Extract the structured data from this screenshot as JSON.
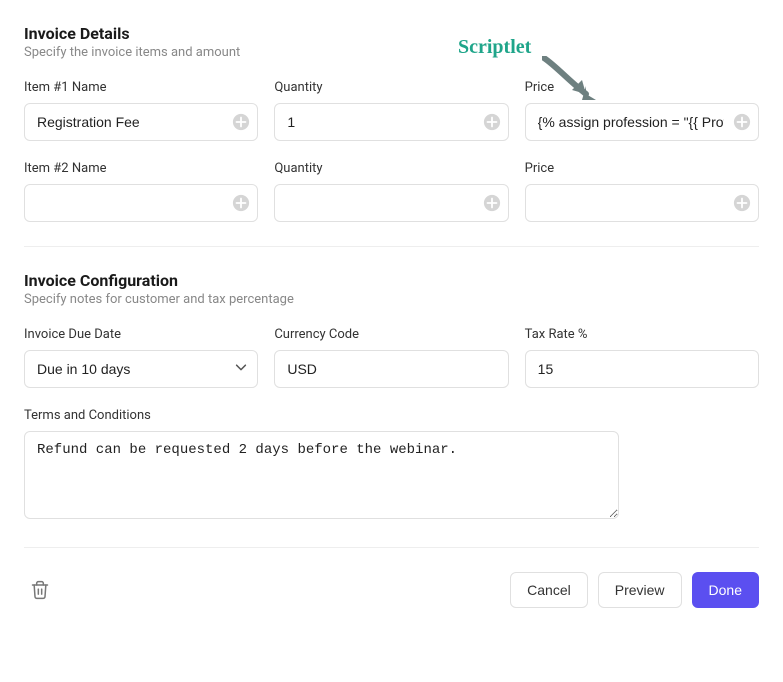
{
  "details": {
    "title": "Invoice Details",
    "subtitle": "Specify the invoice items and amount",
    "annotation": "Scriptlet",
    "items": [
      {
        "name_label": "Item #1 Name",
        "name_value": "Registration Fee",
        "qty_label": "Quantity",
        "qty_value": "1",
        "price_label": "Price",
        "price_value": "{% assign profession = \"{{ Prof"
      },
      {
        "name_label": "Item #2 Name",
        "name_value": "",
        "qty_label": "Quantity",
        "qty_value": "",
        "price_label": "Price",
        "price_value": ""
      }
    ]
  },
  "config": {
    "title": "Invoice Configuration",
    "subtitle": "Specify notes for customer and tax percentage",
    "due_date_label": "Invoice Due Date",
    "due_date_value": "Due in 10 days",
    "currency_label": "Currency Code",
    "currency_value": "USD",
    "tax_label": "Tax Rate %",
    "tax_value": "15",
    "terms_label": "Terms and Conditions",
    "terms_value": "Refund can be requested 2 days before the webinar."
  },
  "footer": {
    "cancel": "Cancel",
    "preview": "Preview",
    "done": "Done"
  }
}
